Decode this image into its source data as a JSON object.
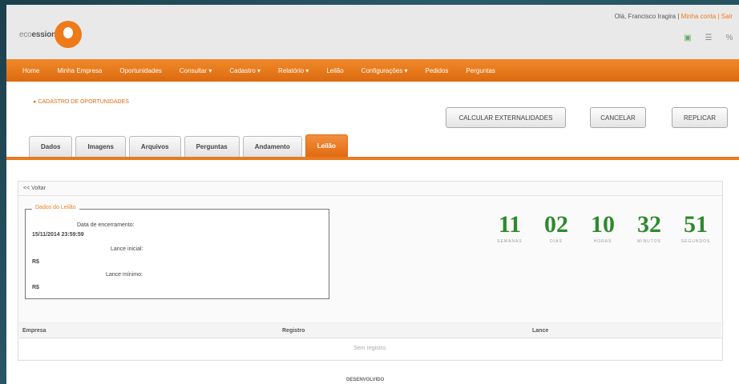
{
  "header": {
    "logo_prefix": "eco",
    "logo_word": "ession",
    "user_greeting": "Olá, Francisco Iragira | ",
    "user_link": "Minha conta | Sair",
    "util_icons": [
      "flag-br-icon",
      "menu-icon",
      "percent-icon"
    ]
  },
  "nav": {
    "items": [
      "Home",
      "Minha Empresa",
      "Oportunidades",
      "Consultar ▾",
      "Cadastro ▾",
      "Relatório ▾",
      "Leilão",
      "Configurações ▾",
      "Pedidos",
      "Perguntas"
    ]
  },
  "breadcrumb": "▸ CADASTRO DE OPORTUNIDADES",
  "actions": {
    "calc": "CALCULAR EXTERNALIDADES",
    "cancel": "CANCELAR",
    "replicate": "REPLICAR"
  },
  "tabs": [
    "Dados",
    "Imagens",
    "Arquivos",
    "Perguntas",
    "Andamento",
    "Leilão"
  ],
  "active_tab": "Leilão",
  "auction": {
    "back_link": "<< Voltar",
    "legend": "Dados do Leilão",
    "end_date_label": "Data de encerramento:",
    "end_date_value": "15/11/2014 23:59:59",
    "initial_bid_label": "Lance inicial:",
    "initial_bid_value": "R$",
    "min_bid_label": "Lance mínimo:",
    "min_bid_value": "R$"
  },
  "countdown": [
    {
      "value": "11",
      "label": "SEMANAS"
    },
    {
      "value": "02",
      "label": "DIAS"
    },
    {
      "value": "10",
      "label": "HORAS"
    },
    {
      "value": "32",
      "label": "MINUTOS"
    },
    {
      "value": "51",
      "label": "SEGUNDOS"
    }
  ],
  "table": {
    "columns": [
      "Empresa",
      "Registro",
      "Lance"
    ],
    "empty_text": "Sem registro."
  },
  "footer_text": "DESENVOLVIDO",
  "colors": {
    "brand": "#ee7a1a",
    "countdown": "#2e8a2e"
  }
}
